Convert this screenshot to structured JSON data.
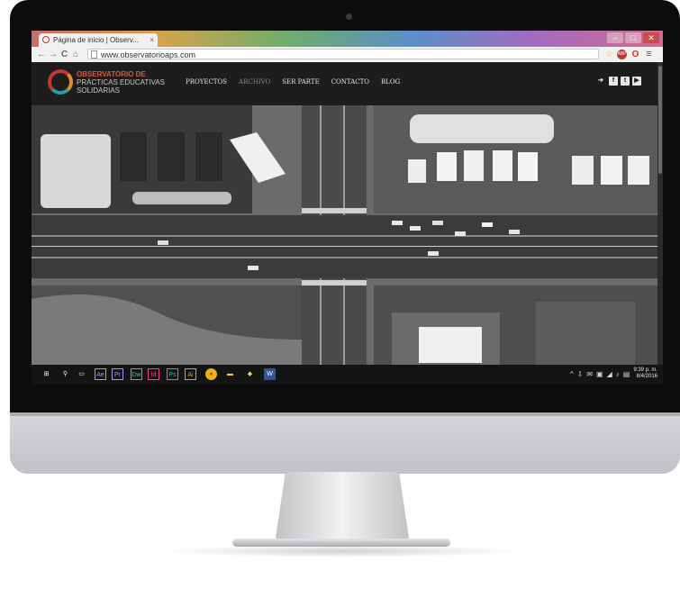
{
  "browser": {
    "tab_title": "Página de inicio | Observ...",
    "tab_close": "×",
    "url": "www.observatorioaps.com",
    "nav": {
      "back": "←",
      "forward": "→",
      "reload": "C",
      "home": "⌂"
    },
    "window_controls": {
      "minimize": "–",
      "maximize": "□",
      "close": "✕"
    },
    "extensions": [
      {
        "icon": "star-icon",
        "glyph": "☆",
        "color": "#e6b422"
      },
      {
        "icon": "adblock-icon",
        "glyph": "ABP",
        "color": "#c0392b"
      },
      {
        "icon": "opera-icon",
        "glyph": "O",
        "color": "#d93025"
      },
      {
        "icon": "menu-icon",
        "glyph": "≡",
        "color": "#555555"
      }
    ]
  },
  "site": {
    "logo": {
      "line1": "OBSERVATORIO DE",
      "line2": "PRÁCTICAS EDUCATIVAS",
      "line3": "SOLIDARIAS"
    },
    "nav": [
      "PROYECTOS",
      "ARCHIVO",
      "SER PARTE",
      "CONTACTO",
      "BLOG"
    ],
    "nav_active_index": 1,
    "social": [
      {
        "icon": "sign-in-icon",
        "glyph": "➔"
      },
      {
        "icon": "facebook-icon",
        "glyph": "f"
      },
      {
        "icon": "twitter-icon",
        "glyph": "t"
      },
      {
        "icon": "youtube-icon",
        "glyph": "▶"
      }
    ],
    "hero_alt": "Aerial photo of an intersection"
  },
  "taskbar": {
    "apps": [
      {
        "icon": "windows-start-icon",
        "glyph": "⊞",
        "color": "#ffffff"
      },
      {
        "icon": "search-icon",
        "glyph": "⚲",
        "color": "#ffffff"
      },
      {
        "icon": "task-view-icon",
        "glyph": "▭",
        "color": "#ffffff"
      },
      {
        "icon": "adobe-ae-icon",
        "glyph": "Ae",
        "color": "#9999ff"
      },
      {
        "icon": "adobe-pr-icon",
        "glyph": "Pr",
        "color": "#9999ff"
      },
      {
        "icon": "adobe-dw-icon",
        "glyph": "Dw",
        "color": "#46c763"
      },
      {
        "icon": "adobe-id-icon",
        "glyph": "Id",
        "color": "#ff3d8b"
      },
      {
        "icon": "adobe-ps-icon",
        "glyph": "Ps",
        "color": "#31a8ff"
      },
      {
        "icon": "adobe-ai-icon",
        "glyph": "Ai",
        "color": "#ff9a00"
      },
      {
        "icon": "chrome-icon",
        "glyph": "●",
        "color": "#e8b31a"
      },
      {
        "icon": "explorer-icon",
        "glyph": "▬",
        "color": "#f4c542"
      },
      {
        "icon": "folder-icon",
        "glyph": "◆",
        "color": "#f4d35e"
      },
      {
        "icon": "word-icon",
        "glyph": "W",
        "color": "#2b579a"
      }
    ],
    "tray": {
      "icons": [
        "^",
        "⇩",
        "✉",
        "▣",
        "◢",
        "♪",
        "▤"
      ],
      "time": "9:39 p. m.",
      "date": "8/4/2016"
    }
  }
}
